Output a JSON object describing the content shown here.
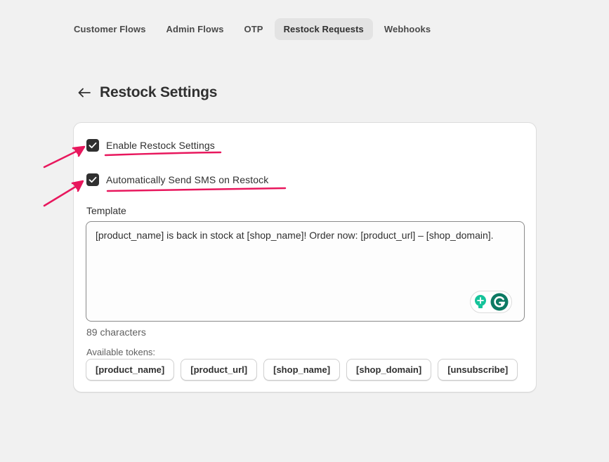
{
  "tabs": [
    {
      "label": "Customer Flows",
      "active": false
    },
    {
      "label": "Admin Flows",
      "active": false
    },
    {
      "label": "OTP",
      "active": false
    },
    {
      "label": "Restock Requests",
      "active": true
    },
    {
      "label": "Webhooks",
      "active": false
    }
  ],
  "header": {
    "back_icon": "arrow-left-icon",
    "title": "Restock Settings"
  },
  "settings": {
    "enable_restock": {
      "label": "Enable Restock Settings",
      "checked": true
    },
    "auto_send_sms": {
      "label": "Automatically Send SMS on Restock",
      "checked": true
    },
    "template_label": "Template",
    "template_value": "[product_name] is back in stock at [shop_name]! Order now: [product_url] – [shop_domain].",
    "char_count": "89 characters",
    "tokens_label": "Available tokens:",
    "tokens": [
      "[product_name]",
      "[product_url]",
      "[shop_name]",
      "[shop_domain]",
      "[unsubscribe]"
    ]
  },
  "colors": {
    "accent": "#303030",
    "annotation": "#e8175d",
    "grammarly_green": "#15c39a",
    "grammarly_dark": "#0c7a63"
  },
  "icons": {
    "grammarly_bulb": "lightbulb-icon",
    "grammarly_logo": "grammarly-icon",
    "checkbox": "checkmark-icon"
  }
}
